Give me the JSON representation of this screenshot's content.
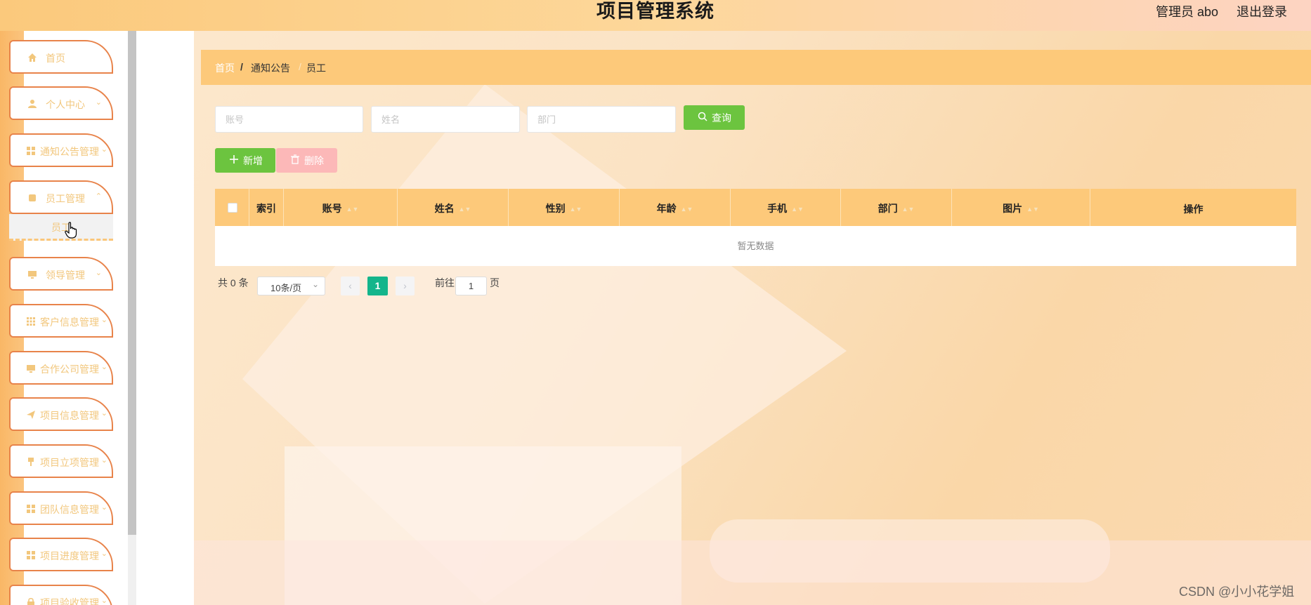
{
  "header": {
    "title": "项目管理系统",
    "user_label": "管理员 abo",
    "logout_label": "退出登录"
  },
  "sidebar": {
    "items": [
      {
        "label": "首页",
        "icon": "home-icon"
      },
      {
        "label": "个人中心",
        "icon": "user-icon"
      },
      {
        "label": "通知公告管理",
        "icon": "grid-icon"
      },
      {
        "label": "员工管理",
        "icon": "square-icon"
      },
      {
        "label": "领导管理",
        "icon": "monitor-icon"
      },
      {
        "label": "客户信息管理",
        "icon": "apps-icon"
      },
      {
        "label": "合作公司管理",
        "icon": "monitor-icon"
      },
      {
        "label": "项目信息管理",
        "icon": "send-icon"
      },
      {
        "label": "项目立项管理",
        "icon": "pin-icon"
      },
      {
        "label": "团队信息管理",
        "icon": "grid-icon"
      },
      {
        "label": "项目进度管理",
        "icon": "grid-icon"
      },
      {
        "label": "项目验收管理",
        "icon": "lock-icon"
      }
    ],
    "sub_item": "员工"
  },
  "breadcrumb": {
    "home": "首页",
    "sep1": "/",
    "second": "通知公告",
    "sep2": "/",
    "current": "员工"
  },
  "search": {
    "account_placeholder": "账号",
    "name_placeholder": "姓名",
    "dept_placeholder": "部门",
    "query_label": "查询"
  },
  "actions": {
    "add_label": "新增",
    "delete_label": "删除"
  },
  "table": {
    "columns": [
      "索引",
      "账号",
      "姓名",
      "性别",
      "年龄",
      "手机",
      "部门",
      "图片",
      "操作"
    ],
    "empty_text": "暂无数据"
  },
  "pagination": {
    "total": "共 0 条",
    "page_size": "10条/页",
    "current": "1",
    "goto_label": "前往",
    "goto_value": "1",
    "page_suffix": "页"
  },
  "watermark": "CSDN @小小花学姐"
}
